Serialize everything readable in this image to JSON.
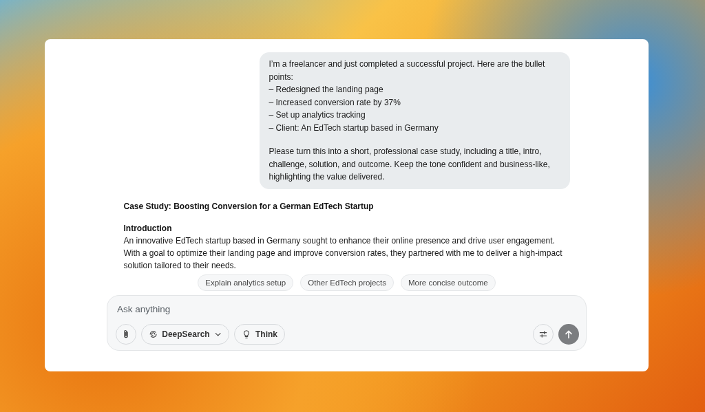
{
  "user_message": {
    "intro": "I’m a freelancer and just completed a successful project. Here are the bullet points:",
    "bullets": [
      "– Redesigned the landing page",
      "– Increased conversion rate by 37%",
      "– Set up analytics tracking",
      "– Client: An EdTech startup based in Germany"
    ],
    "request": "Please turn this into a short, professional case study, including a title, intro, challenge, solution, and outcome. Keep the tone confident and business-like, highlighting the value delivered."
  },
  "response": {
    "title": "Case Study: Boosting Conversion for a German EdTech Startup",
    "sections": [
      {
        "heading": "Introduction",
        "body": "An innovative EdTech startup based in Germany sought to enhance their online presence and drive user engagement. With a goal to optimize their landing page and improve conversion rates, they partnered with me to deliver a high-impact solution tailored to their needs."
      }
    ]
  },
  "suggestions": [
    "Explain analytics setup",
    "Other EdTech projects",
    "More concise outcome"
  ],
  "composer": {
    "placeholder": "Ask anything",
    "tools": [
      {
        "kind": "attach"
      },
      {
        "kind": "mode",
        "label": "DeepSearch"
      },
      {
        "kind": "think",
        "label": "Think"
      }
    ]
  }
}
